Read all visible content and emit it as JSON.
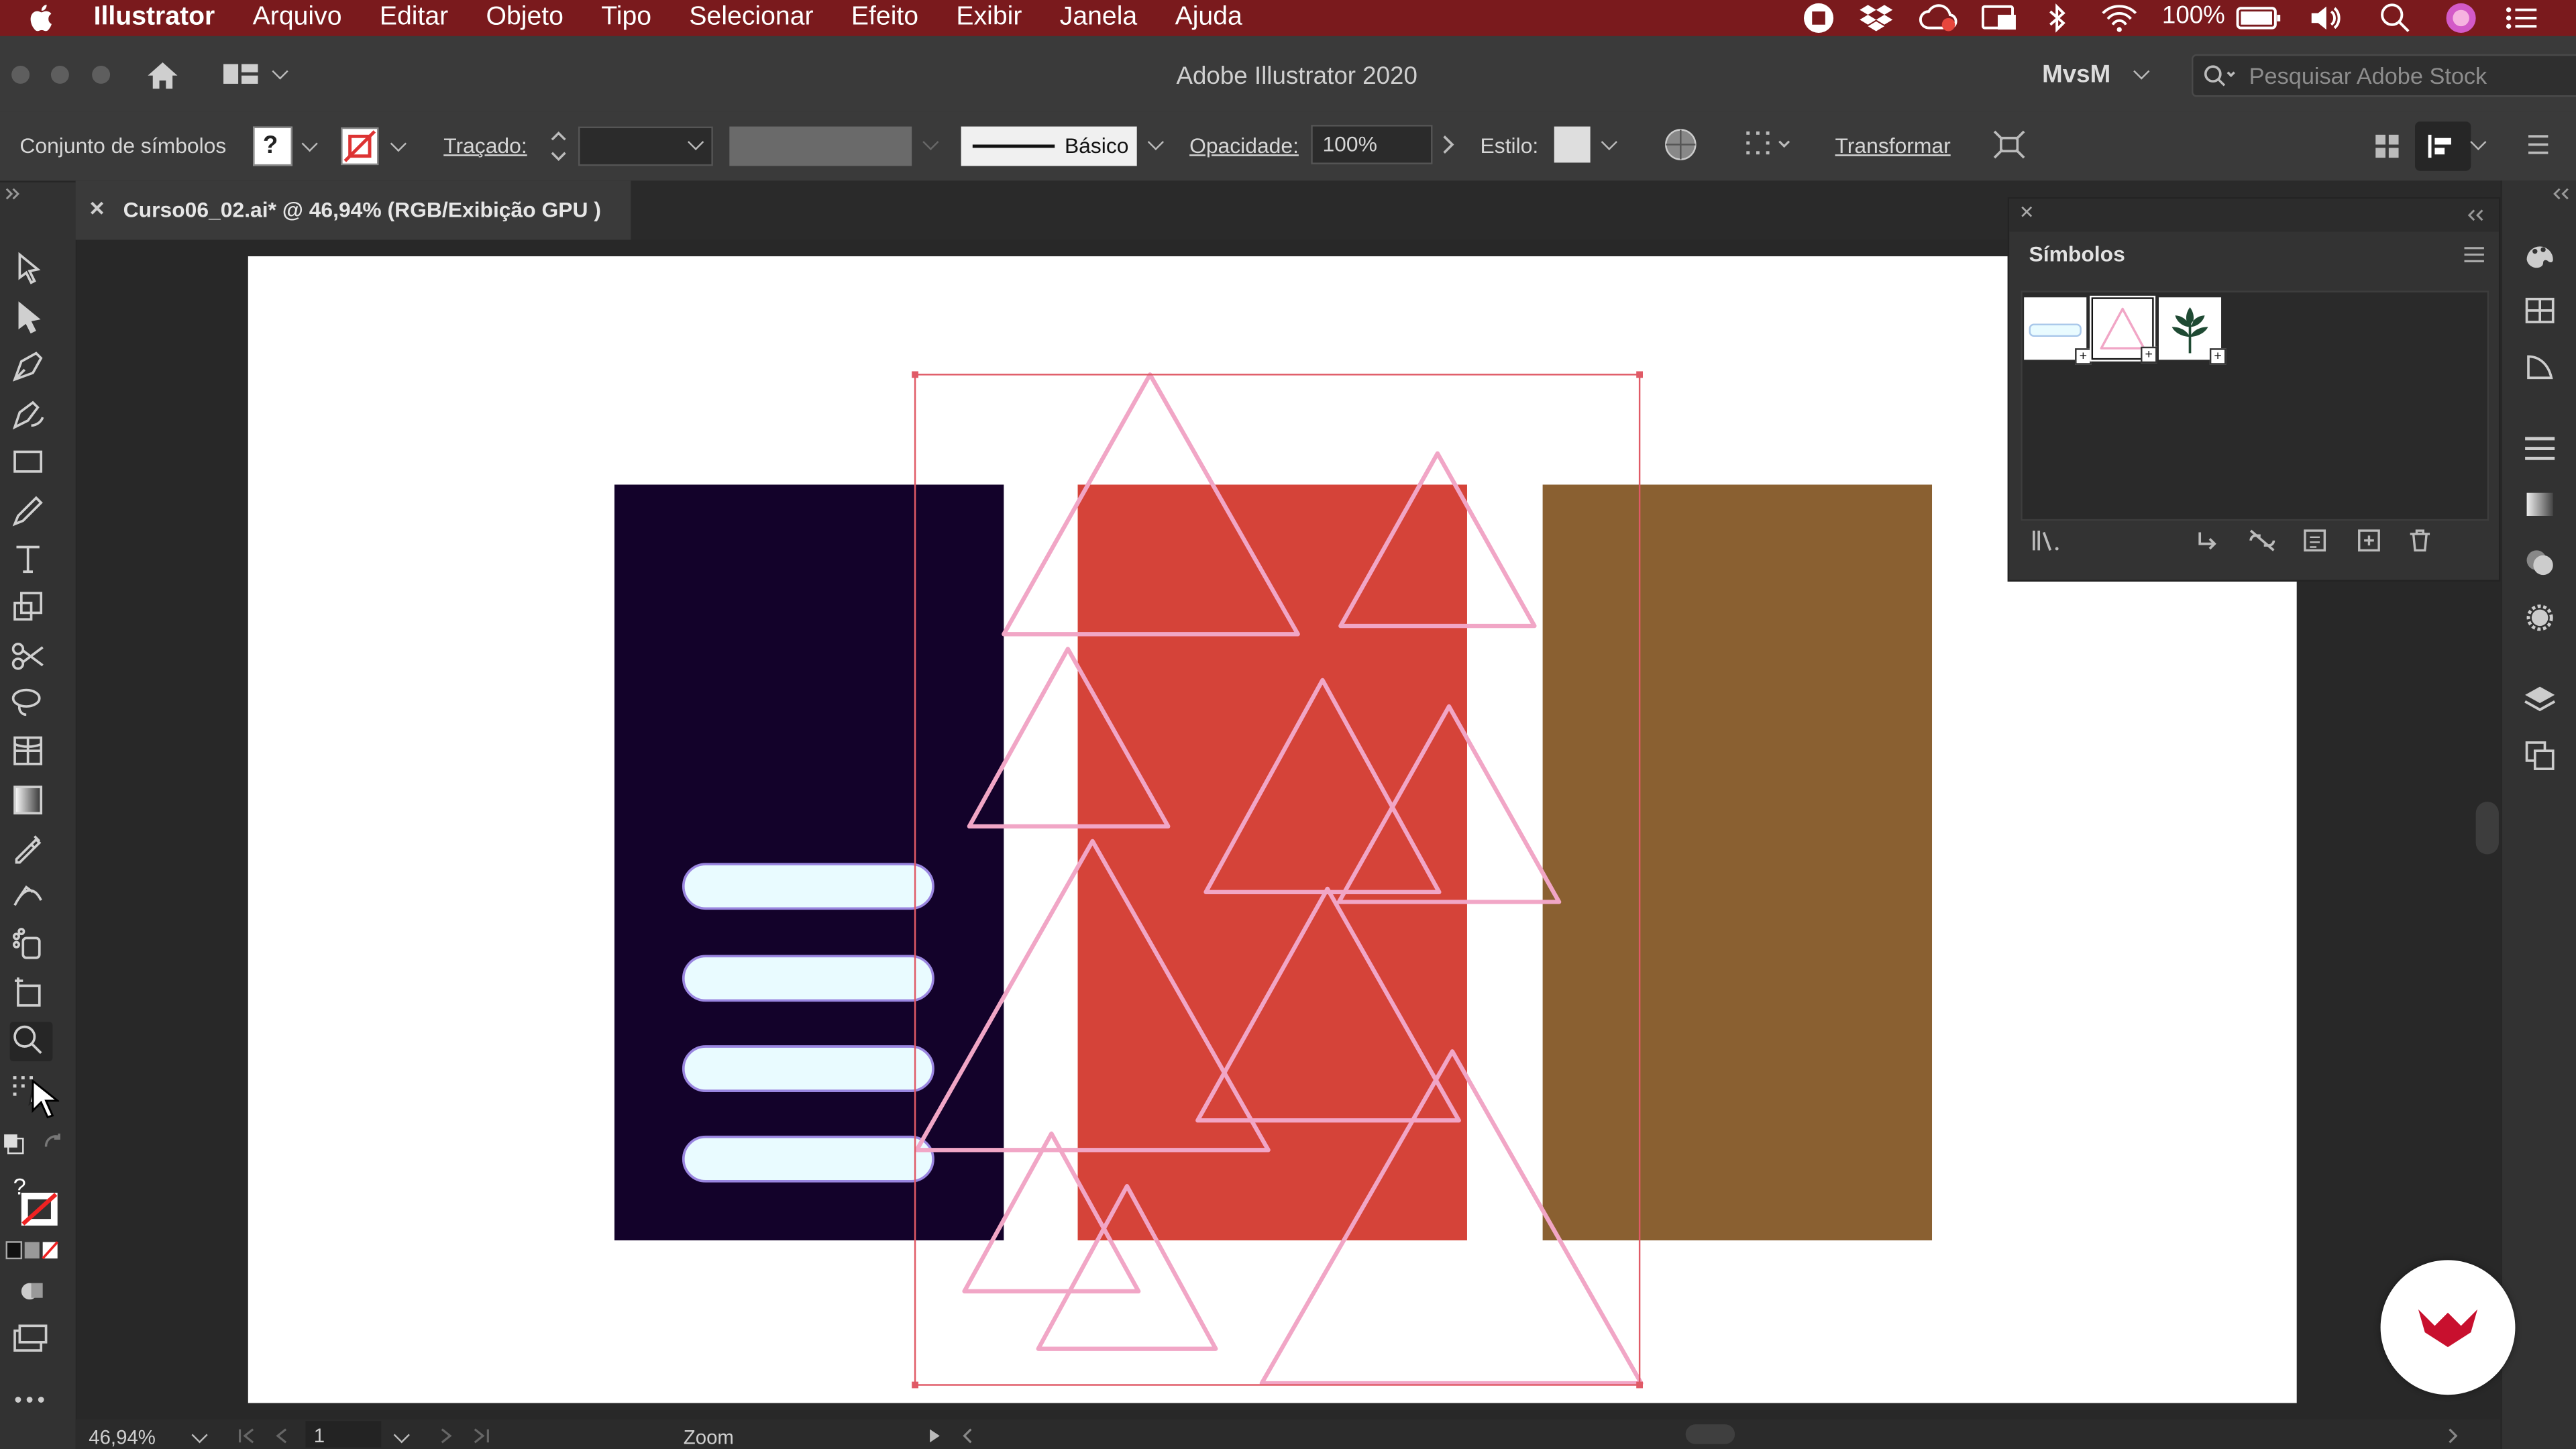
{
  "menubar": {
    "apple": "",
    "items": [
      "Illustrator",
      "Arquivo",
      "Editar",
      "Objeto",
      "Tipo",
      "Selecionar",
      "Efeito",
      "Exibir",
      "Janela",
      "Ajuda"
    ],
    "battery": "100%"
  },
  "titlebar": {
    "title": "Adobe Illustrator 2020",
    "workspace": "MvsM",
    "search_placeholder": "Pesquisar Adobe Stock"
  },
  "controlbar": {
    "symbol_set_label": "Conjunto de símbolos",
    "fill_value": "?",
    "stroke_label": "Traçado:",
    "brush_label": "Básico",
    "opacity_label": "Opacidade:",
    "opacity_value": "100%",
    "style_label": "Estilo:",
    "transform_label": "Transformar"
  },
  "document": {
    "tab_title": "Curso06_02.ai* @ 46,94% (RGB/Exibição GPU )",
    "close_glyph": "✕"
  },
  "artwork": {
    "colors": {
      "navy": "#13022a",
      "red": "#d54339",
      "brown": "#8a6031",
      "pill": "#e9fbff",
      "pill_stroke": "#9a86e0",
      "triangle_stroke": "#f1a6c6",
      "selection": "#e05a66"
    }
  },
  "symbols_panel": {
    "title": "Símbolos",
    "symbols": [
      "pill-symbol",
      "triangle-symbol",
      "plant-symbol"
    ]
  },
  "toolbar": {
    "fill_question": "?"
  },
  "statusbar": {
    "zoom": "46,94%",
    "page": "1",
    "tool": "Zoom"
  },
  "accent": {
    "menubar_bg": "#7a1a1d",
    "badge": "#c8102e"
  }
}
